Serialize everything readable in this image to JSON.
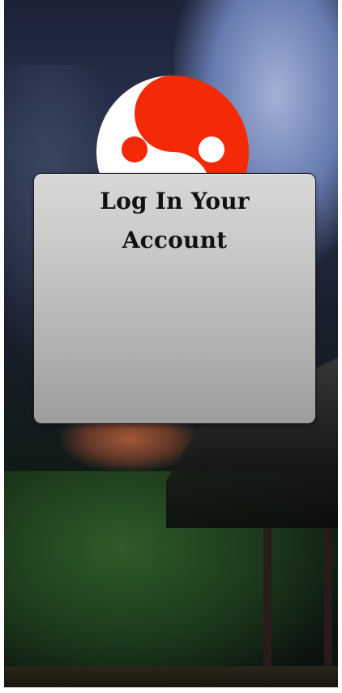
{
  "login_card": {
    "title": "Log In Your Account"
  },
  "logo": {
    "icon": "yin-yang-icon",
    "colors": {
      "primary": "#f42a06",
      "secondary": "#ffffff"
    }
  }
}
